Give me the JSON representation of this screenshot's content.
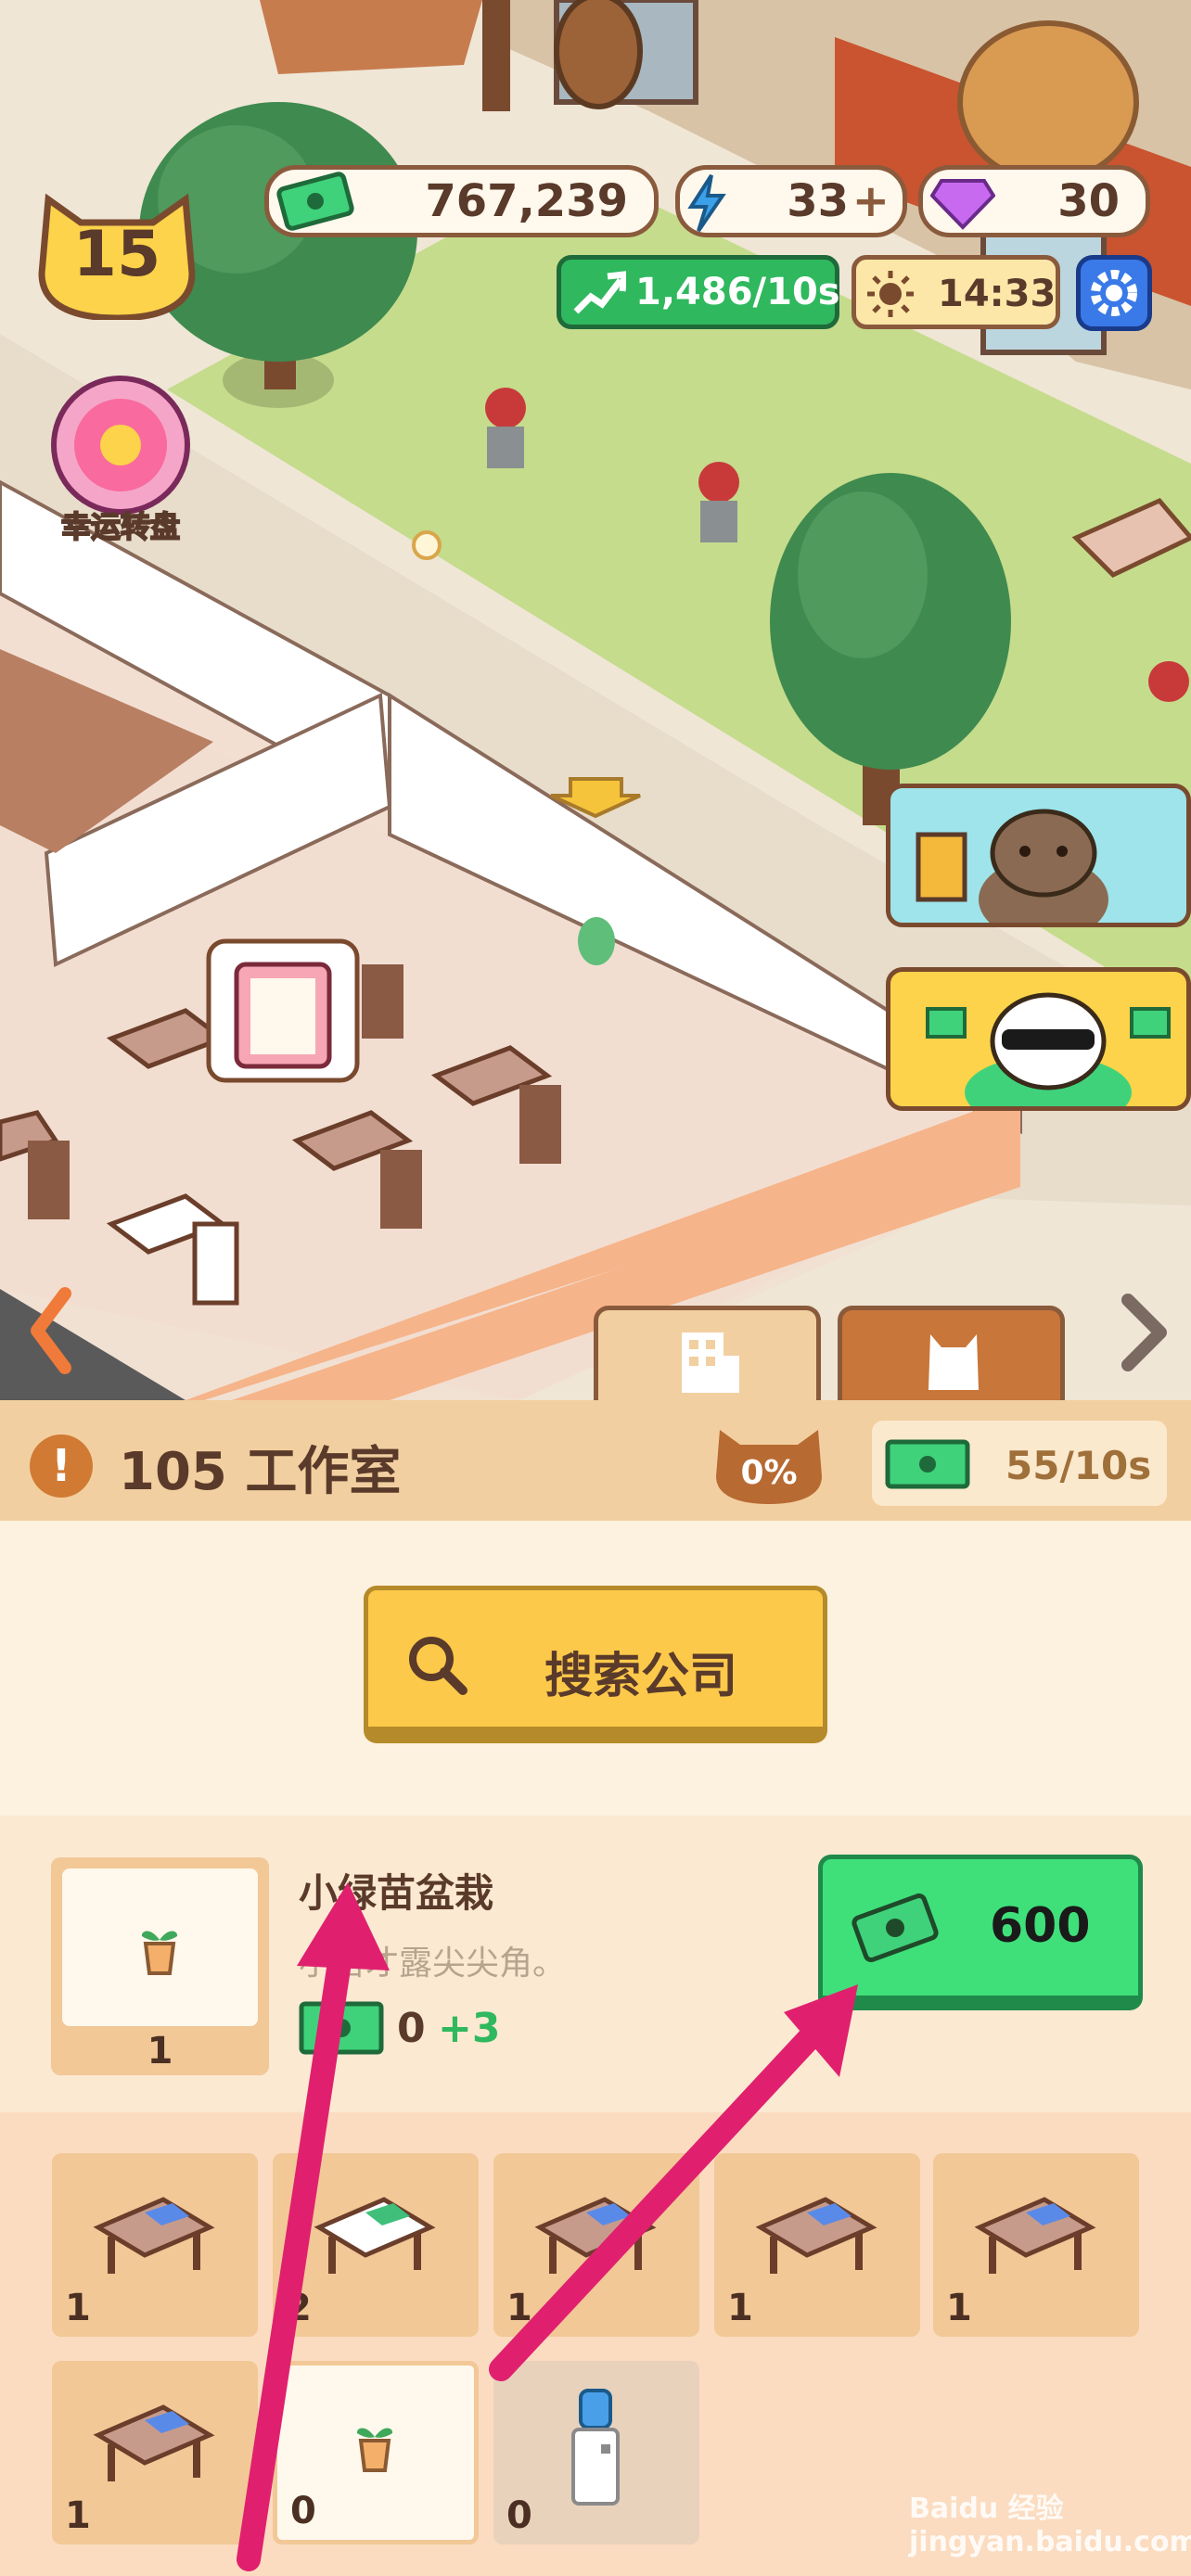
{
  "hud": {
    "level": "15",
    "cash": "767,239",
    "energy": "33",
    "gems": "30",
    "income_rate": "1,486/10s",
    "time": "14:33",
    "lucky_wheel_label": "幸运转盘"
  },
  "room": {
    "title": "105 工作室",
    "progress_percent": "0%",
    "income": "55/10s",
    "search_button_label": "搜索公司"
  },
  "item": {
    "name": "小绿苗盆栽",
    "description": "小苗才露尖尖角。",
    "owned_count": "1",
    "income_value": "0",
    "income_bonus": "+3",
    "price": "600"
  },
  "inventory": [
    {
      "type": "desk-blue",
      "count": "1"
    },
    {
      "type": "desk-white",
      "count": "2"
    },
    {
      "type": "desk-blue",
      "count": "1"
    },
    {
      "type": "desk-blue",
      "count": "1"
    },
    {
      "type": "desk-blue",
      "count": "1"
    },
    {
      "type": "desk-blue",
      "count": "1"
    },
    {
      "type": "plant",
      "count": "0"
    },
    {
      "type": "water-cooler",
      "count": "0"
    }
  ],
  "watermark": "Baidu 经验 jingyan.baidu.com",
  "colors": {
    "accent_green": "#3fd27a",
    "panel_header": "#f2cfa0",
    "panel_bg": "#fdf1df",
    "search_button": "#fcc94a",
    "annotation_arrow": "#e0206e"
  }
}
